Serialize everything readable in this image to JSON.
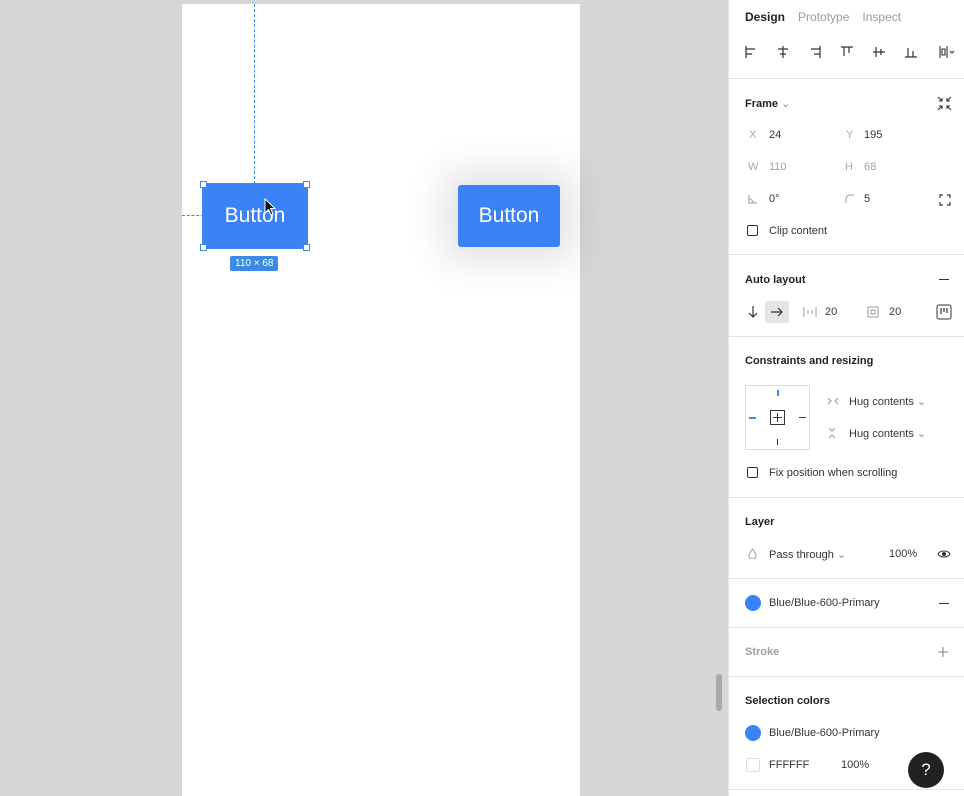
{
  "canvas": {
    "selected_button_label": "Button",
    "copy_button_label": "Button",
    "size_badge": "110 × 68"
  },
  "panel": {
    "tabs": [
      "Design",
      "Prototype",
      "Inspect"
    ],
    "frame": {
      "title": "Frame",
      "x_label": "X",
      "x_value": "24",
      "y_label": "Y",
      "y_value": "195",
      "w_label": "W",
      "w_value": "110",
      "h_label": "H",
      "h_value": "68",
      "rotation_value": "0°",
      "radius_value": "5",
      "clip_label": "Clip content"
    },
    "auto_layout": {
      "title": "Auto layout",
      "spacing_value": "20",
      "padding_value": "20"
    },
    "constraints": {
      "title": "Constraints and resizing",
      "horizontal": "Hug contents",
      "vertical": "Hug contents",
      "fix_label": "Fix position when scrolling"
    },
    "layer": {
      "title": "Layer",
      "blend": "Pass through",
      "opacity": "100%"
    },
    "fill": {
      "style_name": "Blue/Blue-600-Primary",
      "color": "#3b82f6"
    },
    "stroke": {
      "title": "Stroke"
    },
    "selection_colors": {
      "title": "Selection colors",
      "items": [
        {
          "name": "Blue/Blue-600-Primary",
          "color": "#3b82f6",
          "opacity": ""
        },
        {
          "name": "FFFFFF",
          "color": "#ffffff",
          "opacity": "100%"
        }
      ]
    },
    "help_label": "?"
  }
}
